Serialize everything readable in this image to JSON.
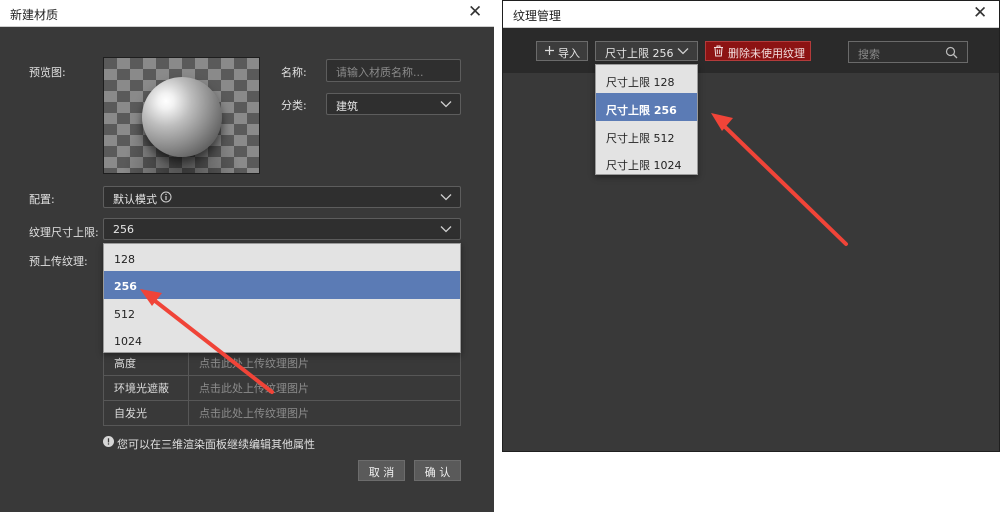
{
  "left_dialog": {
    "title": "新建材质",
    "close_glyph": "✕",
    "preview_label": "预览图:",
    "name_label": "名称:",
    "name_placeholder": "请输入材质名称...",
    "category_label": "分类:",
    "category_value": "建筑",
    "config_label": "配置:",
    "config_value": "默认模式",
    "texture_limit_label": "纹理尺寸上限:",
    "texture_limit_value": "256",
    "preupload_label": "预上传纹理:",
    "dropdown_options": [
      "128",
      "256",
      "512",
      "1024"
    ],
    "dropdown_selected": "256",
    "texture_rows": [
      {
        "name": "高度",
        "hint": "点击此处上传纹理图片"
      },
      {
        "name": "环境光遮蔽",
        "hint": "点击此处上传纹理图片"
      },
      {
        "name": "自发光",
        "hint": "点击此处上传纹理图片"
      }
    ],
    "notice": "您可以在三维渲染面板继续编辑其他属性",
    "cancel_label": "取 消",
    "confirm_label": "确 认"
  },
  "right_window": {
    "title": "纹理管理",
    "close_glyph": "✕",
    "import_label": "导入",
    "size_select_value": "尺寸上限 256",
    "delete_unused_label": "删除未使用纹理",
    "search_placeholder": "搜索",
    "dropdown_options": [
      "尺寸上限 128",
      "尺寸上限 256",
      "尺寸上限 512",
      "尺寸上限 1024"
    ],
    "dropdown_selected": "尺寸上限 256"
  },
  "colors": {
    "dialog_bg": "#393939",
    "selection_blue": "#5b7bb5",
    "danger_red": "#8c1313",
    "annotation_arrow": "#f04438"
  },
  "icons": [
    "close-icon",
    "chevron-down-icon",
    "info-icon",
    "plus-icon",
    "trash-icon",
    "search-icon",
    "annotation-arrow"
  ]
}
